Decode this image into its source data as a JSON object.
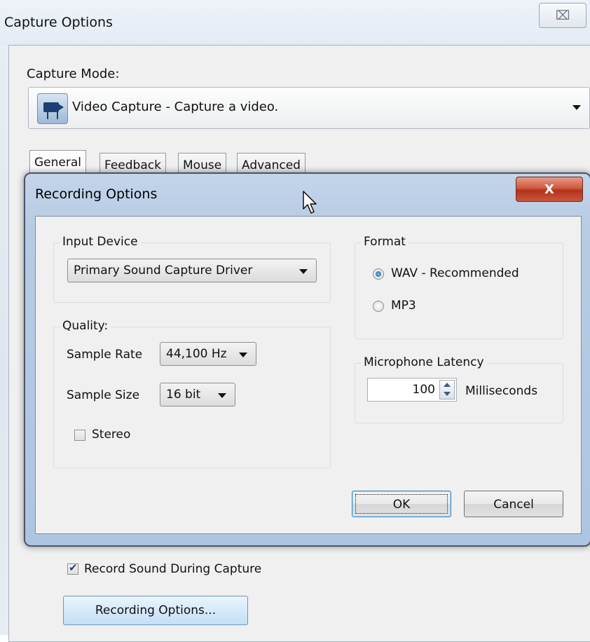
{
  "background_window": {
    "title": "Capture Options",
    "close_glyph": "⌧",
    "capture_mode_label": "Capture Mode:",
    "capture_mode_value": "Video Capture - Capture a video.",
    "tabs": [
      "General",
      "Feedback",
      "Mouse",
      "Advanced"
    ],
    "record_sound_label": "Record Sound During Capture",
    "record_sound_checked": true,
    "recording_options_button": "Recording Options..."
  },
  "dialog": {
    "title": "Recording Options",
    "close_glyph": "X",
    "input_device": {
      "group_label": "Input Device",
      "value": "Primary Sound Capture Driver"
    },
    "quality": {
      "group_label": "Quality:",
      "sample_rate_label": "Sample Rate",
      "sample_rate_value": "44,100 Hz",
      "sample_size_label": "Sample Size",
      "sample_size_value": "16 bit",
      "stereo_label": "Stereo",
      "stereo_checked": false
    },
    "format": {
      "group_label": "Format",
      "options": [
        {
          "label": "WAV - Recommended",
          "selected": true
        },
        {
          "label": "MP3",
          "selected": false
        }
      ]
    },
    "latency": {
      "group_label": "Microphone Latency",
      "value": "100",
      "unit": "Milliseconds"
    },
    "ok_label": "OK",
    "cancel_label": "Cancel"
  },
  "colors": {
    "close_red": "#c9563e",
    "dialog_frame": "#b7cbe4",
    "radio_selected": "#1f5fb0"
  }
}
